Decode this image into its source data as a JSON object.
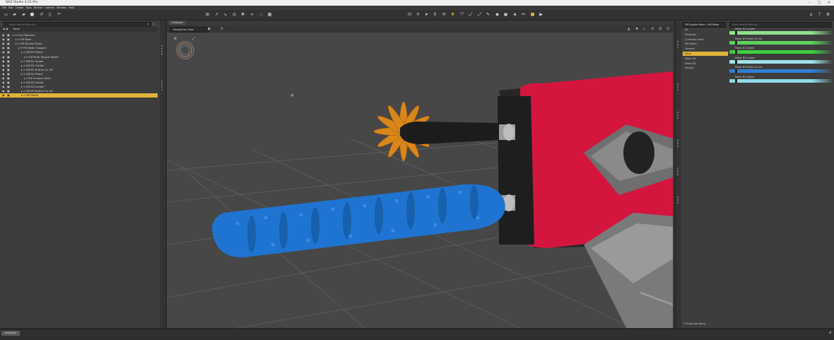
{
  "window": {
    "title": "DAZ Studio 4.21 Pro"
  },
  "menu": [
    "File",
    "Edit",
    "Create",
    "Tools",
    "Render",
    "Camera",
    "Window",
    "Help"
  ],
  "scene": {
    "search_placeholder": "Enter text to filter by...",
    "column_header": "Node",
    "rows": [
      {
        "label": "Fuck Machine",
        "indent": 1
      },
      {
        "label": "FM Base",
        "indent": 2
      },
      {
        "label": "FM Double Motor",
        "indent": 2
      },
      {
        "label": "FM Motor Support",
        "indent": 3
      },
      {
        "label": "DM B1 Piston",
        "indent": 4
      },
      {
        "label": "FM Multi Tongue Wheel",
        "indent": 5
      },
      {
        "label": "DM B1 Speed",
        "indent": 4
      },
      {
        "label": "DM B1 Limiter",
        "indent": 4
      },
      {
        "label": "DM B1 Button On Off",
        "indent": 4
      },
      {
        "label": "DM B2 Piston",
        "indent": 4
      },
      {
        "label": "FM Scraper Dildo",
        "indent": 5
      },
      {
        "label": "DM B2 Speed",
        "indent": 4
      },
      {
        "label": "DM B2 Limiter",
        "indent": 4
      },
      {
        "label": "DM B2 Button On Off",
        "indent": 4
      },
      {
        "label": "DM Motor",
        "indent": 4,
        "selected": true
      }
    ]
  },
  "viewport": {
    "tab_label": "Viewport",
    "view_select": "Perspective View"
  },
  "parameters": {
    "node_select": "FM Double Motor : DM Motor",
    "search_placeholder": "Enter text to filter by...",
    "filter_items": [
      {
        "label": "All"
      },
      {
        "label": "Favorites"
      },
      {
        "label": "Currently Used"
      },
      {
        "label": "DM Motor"
      },
      {
        "label": "General"
      },
      {
        "label": "Actor",
        "selected": true
      },
      {
        "label": "Motor B1"
      },
      {
        "label": "Motor B2"
      },
      {
        "label": "Display"
      }
    ],
    "sliders": [
      {
        "label": "Motor B1 Limiter",
        "color": "#8fe08f"
      },
      {
        "label": "Motor B1 Piston In Out",
        "color": "#5bd35b"
      },
      {
        "label": "Motor B1 Speed",
        "color": "#3ecf3e"
      },
      {
        "label": "Motor B2 Limiter",
        "color": "#9fe3ea"
      },
      {
        "label": "Motor B2 Piston In Out",
        "color": "#2f7fd6"
      },
      {
        "label": "Motor B2 Speed",
        "color": "#8fd9e8"
      }
    ],
    "show_sub_items": "Show Sub Items"
  },
  "status": {
    "button": "tentative"
  },
  "colors": {
    "selection": "#e0b43a",
    "device_body": "#d4163f",
    "roller": "#1f74d1",
    "wheel": "#d9861a"
  }
}
